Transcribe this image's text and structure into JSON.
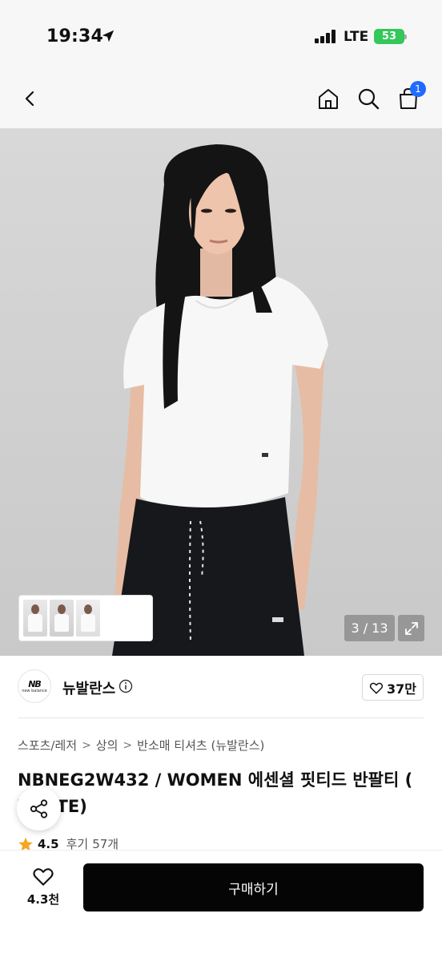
{
  "status_bar": {
    "time": "19:34",
    "carrier": "LTE",
    "battery": "53"
  },
  "nav": {
    "cart_badge": "1"
  },
  "gallery": {
    "counter": "3 / 13"
  },
  "brand": {
    "name": "뉴발란스",
    "logo_text": "NB",
    "logo_subtext": "new balance",
    "likes": "37만"
  },
  "breadcrumb": [
    "스포츠/레저",
    "상의",
    "반소매 티셔츠 (뉴발란스)"
  ],
  "product": {
    "title_line1": "NBNEG2W432 / WOMEN 에센셜 핏티드 반팔티 (",
    "title_line2": "WHITE)"
  },
  "rating": {
    "score": "4.5",
    "review_label": "후기",
    "review_count": "57개"
  },
  "bottom_bar": {
    "wish_count": "4.3천",
    "buy_label": "구매하기"
  },
  "colors": {
    "accent_blue": "#1f6bff",
    "buy_button": "#050505",
    "star": "#f5a623",
    "battery": "#34c759"
  }
}
